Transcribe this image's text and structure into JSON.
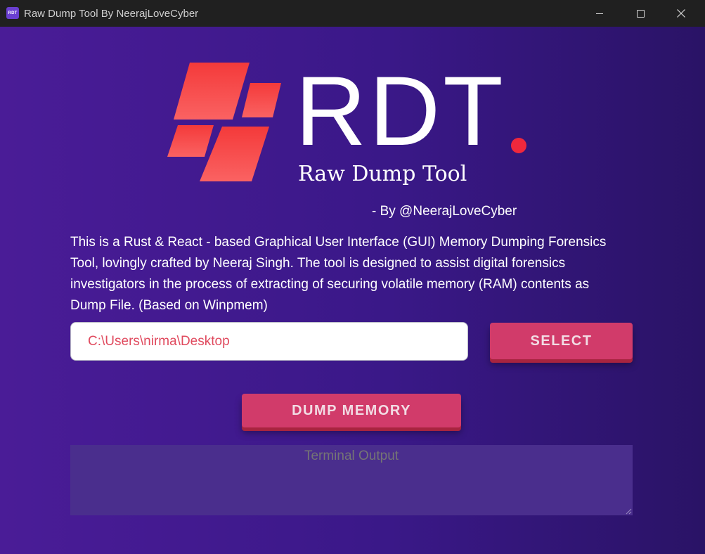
{
  "window": {
    "title": "Raw Dump Tool By NeerajLoveCyber",
    "app_icon_text": "RDT",
    "controls": {
      "minimize": "minimize",
      "maximize": "maximize",
      "close": "close"
    }
  },
  "logo": {
    "wordmark": "RDT",
    "subtitle": "Raw Dump Tool",
    "byline": "- By @NeerajLoveCyber",
    "colors": {
      "tile_top": "#f43a3a",
      "tile_bottom": "#fa6262",
      "dot": "#f0283c"
    }
  },
  "description": "This is a Rust & React - based Graphical User Interface (GUI) Memory Dumping Forensics Tool, lovingly crafted by Neeraj Singh. The tool is designed to assist digital forensics investigators in the process of extracting of securing volatile memory (RAM) contents as Dump File. (Based on Winpmem)",
  "path_input": {
    "value": "C:\\Users\\nirma\\Desktop"
  },
  "buttons": {
    "select": "SELECT",
    "dump": "DUMP MEMORY"
  },
  "terminal": {
    "placeholder": "Terminal Output"
  },
  "colors": {
    "accent": "#d13b6a",
    "background_start": "#4a1c97",
    "background_end": "#2a1366",
    "titlebar": "#202020"
  }
}
